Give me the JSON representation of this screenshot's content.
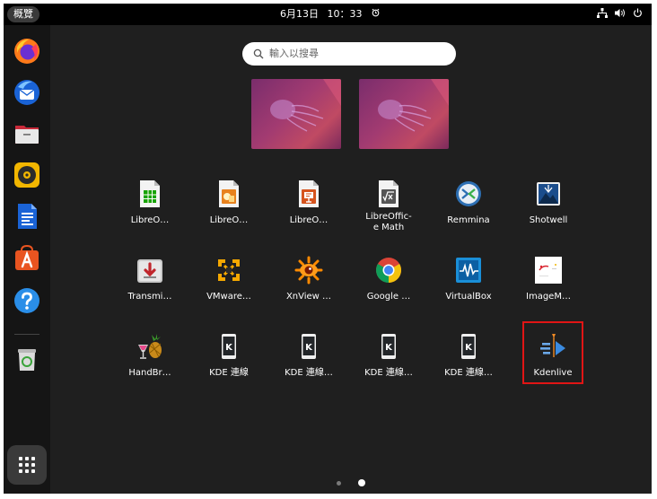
{
  "topbar": {
    "activities_label": "概覽",
    "date": "6月13日",
    "time": "10：33"
  },
  "search": {
    "placeholder": "輸入以搜尋"
  },
  "dock": {
    "items": [
      "firefox-icon",
      "thunderbird-icon",
      "files-icon",
      "rhythmbox-icon",
      "writer-icon",
      "app-center-icon",
      "help-icon",
      "trash-icon"
    ]
  },
  "apps": [
    {
      "label": "LibreO…",
      "icon": "libreoffice-calc-icon"
    },
    {
      "label": "LibreO…",
      "icon": "libreoffice-impress-icon"
    },
    {
      "label": "LibreO…",
      "icon": "libreoffice-impress-alt-icon"
    },
    {
      "label": "LibreOffic-\ne Math",
      "icon": "libreoffice-math-icon"
    },
    {
      "label": "Remmina",
      "icon": "remmina-icon"
    },
    {
      "label": "Shotwell",
      "icon": "shotwell-icon"
    },
    {
      "label": "Transmi…",
      "icon": "transmission-icon"
    },
    {
      "label": "VMware…",
      "icon": "vmware-icon"
    },
    {
      "label": "XnView …",
      "icon": "xnview-icon"
    },
    {
      "label": "Google …",
      "icon": "chrome-icon"
    },
    {
      "label": "VirtualBox",
      "icon": "virtualbox-icon"
    },
    {
      "label": "ImageM…",
      "icon": "imagemagick-icon"
    },
    {
      "label": "HandBr…",
      "icon": "handbrake-icon"
    },
    {
      "label": "KDE 連線",
      "icon": "kdeconnect-icon"
    },
    {
      "label": "KDE 連線…",
      "icon": "kdeconnect-icon"
    },
    {
      "label": "KDE 連線…",
      "icon": "kdeconnect-icon"
    },
    {
      "label": "KDE 連線…",
      "icon": "kdeconnect-icon"
    },
    {
      "label": "Kdenlive",
      "icon": "kdenlive-icon"
    }
  ],
  "colors": {
    "highlight": "#e01515",
    "panel": "#000000",
    "background": "#1f1f1f"
  }
}
